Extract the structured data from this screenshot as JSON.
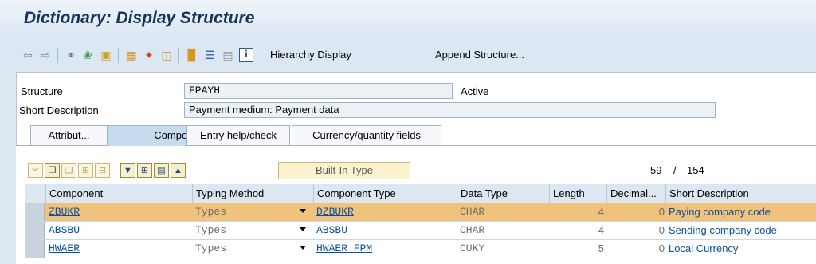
{
  "window": {
    "title": "Dictionary: Display Structure"
  },
  "toolbar": {
    "hierarchy_label": "Hierarchy Display",
    "append_label": "Append Structure..."
  },
  "header": {
    "structure_label": "Structure",
    "structure_value": "FPAYH",
    "status": "Active",
    "desc_label": "Short Description",
    "desc_value": "Payment medium: Payment data"
  },
  "tabs": [
    {
      "label": "Attribut..."
    },
    {
      "label": "Components"
    },
    {
      "label": "Entry help/check"
    },
    {
      "label": "Currency/quantity fields"
    }
  ],
  "components": {
    "builtin_label": "Built-In Type",
    "current": "59",
    "sep": "/",
    "total": "154",
    "columns": [
      "Component",
      "Typing Method",
      "Component Type",
      "Data Type",
      "Length",
      "Decimal...",
      "Short Description"
    ],
    "rows": [
      {
        "component": "ZBUKR",
        "typing": "Types",
        "comptype": "DZBUKR",
        "datatype": "CHAR",
        "length": "4",
        "decimals": "0",
        "desc": "Paying company code"
      },
      {
        "component": "ABSBU",
        "typing": "Types",
        "comptype": "ABSBU",
        "datatype": "CHAR",
        "length": "4",
        "decimals": "0",
        "desc": "Sending company code"
      },
      {
        "component": "HWAER",
        "typing": "Types",
        "comptype": "HWAER_FPM",
        "datatype": "CUKY",
        "length": "5",
        "decimals": "0",
        "desc": "Local Currency"
      }
    ]
  },
  "colors": {
    "title": "#14345c",
    "selected_row": "#f0c27b",
    "link": "#0b4fa0"
  }
}
